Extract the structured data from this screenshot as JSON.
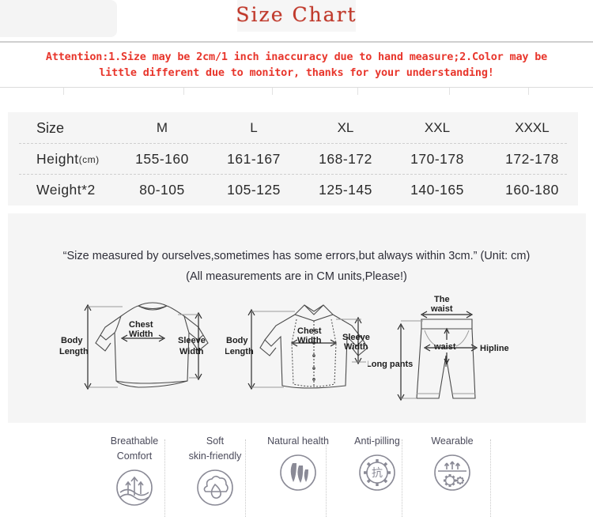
{
  "title": "Size Chart",
  "attention": {
    "line1": "Attention:1.Size may be 2cm/1 inch inaccuracy due to hand measure;2.Color may be",
    "line2": "little different due to monitor, thanks for your understanding!"
  },
  "size_table": {
    "row_labels": [
      "Size",
      "Height",
      "Weight*2"
    ],
    "height_unit": "(cm)",
    "columns": [
      "M",
      "L",
      "XL",
      "XXL",
      "XXXL"
    ],
    "rows": [
      {
        "label": "Height",
        "unit": "(cm)",
        "values": [
          "155-160",
          "161-167",
          "168-172",
          "170-178",
          "172-178"
        ]
      },
      {
        "label": "Weight*2",
        "unit": "",
        "values": [
          "80-105",
          "105-125",
          "125-145",
          "140-165",
          "160-180"
        ]
      }
    ]
  },
  "notes": {
    "line1": "“Size measured by ourselves,sometimes has some errors,but always within 3cm.” (Unit: cm)",
    "line2": "(All measurements are in CM units,Please!)"
  },
  "diagrams": {
    "sweater": {
      "name": "long-sleeve-sweater",
      "labels": {
        "body_length_l1": "Body",
        "body_length_l2": "Length",
        "chest_width_l1": "Chest",
        "chest_width_l2": "Width",
        "sleeve_width_l1": "Sleeve",
        "sleeve_width_l2": "Width"
      }
    },
    "shirt": {
      "name": "button-down-shirt",
      "labels": {
        "body_length_l1": "Body",
        "body_length_l2": "Length",
        "chest_width_l1": "Chest",
        "chest_width_l2": "Width",
        "sleeve_width_l1": "Sleeve",
        "sleeve_width_l2": "Width"
      }
    },
    "pants": {
      "name": "long-pants",
      "labels": {
        "the_waist_l1": "The",
        "the_waist_l2": "waist",
        "waist": "waist",
        "hipline": "Hipline",
        "long_pants": "Long pants"
      }
    }
  },
  "features": [
    {
      "name": "breathable-comfort",
      "line1": "Breathable",
      "line2": "Comfort",
      "icon": "breathable-icon"
    },
    {
      "name": "soft-skin-friendly",
      "line1": "Soft",
      "line2": "skin-friendly",
      "icon": "water-drop-cloud-icon"
    },
    {
      "name": "natural-health",
      "line1": "Natural health",
      "line2": "",
      "icon": "leaf-icon"
    },
    {
      "name": "anti-pilling",
      "line1": "Anti-pilling",
      "line2": "",
      "icon": "gear-kang-icon"
    },
    {
      "name": "wearable",
      "line1": "Wearable",
      "line2": "",
      "icon": "gears-icon"
    }
  ],
  "feature_icon_glyphs": {
    "anti_pilling_char": "抗"
  },
  "colors": {
    "title_red": "#c0392b",
    "attention_red": "#e8362c",
    "panel_gray": "#f5f5f5",
    "note_text": "#2e2e38",
    "feature_text": "#4a4a5a",
    "icon_stroke": "#8a8a96"
  }
}
